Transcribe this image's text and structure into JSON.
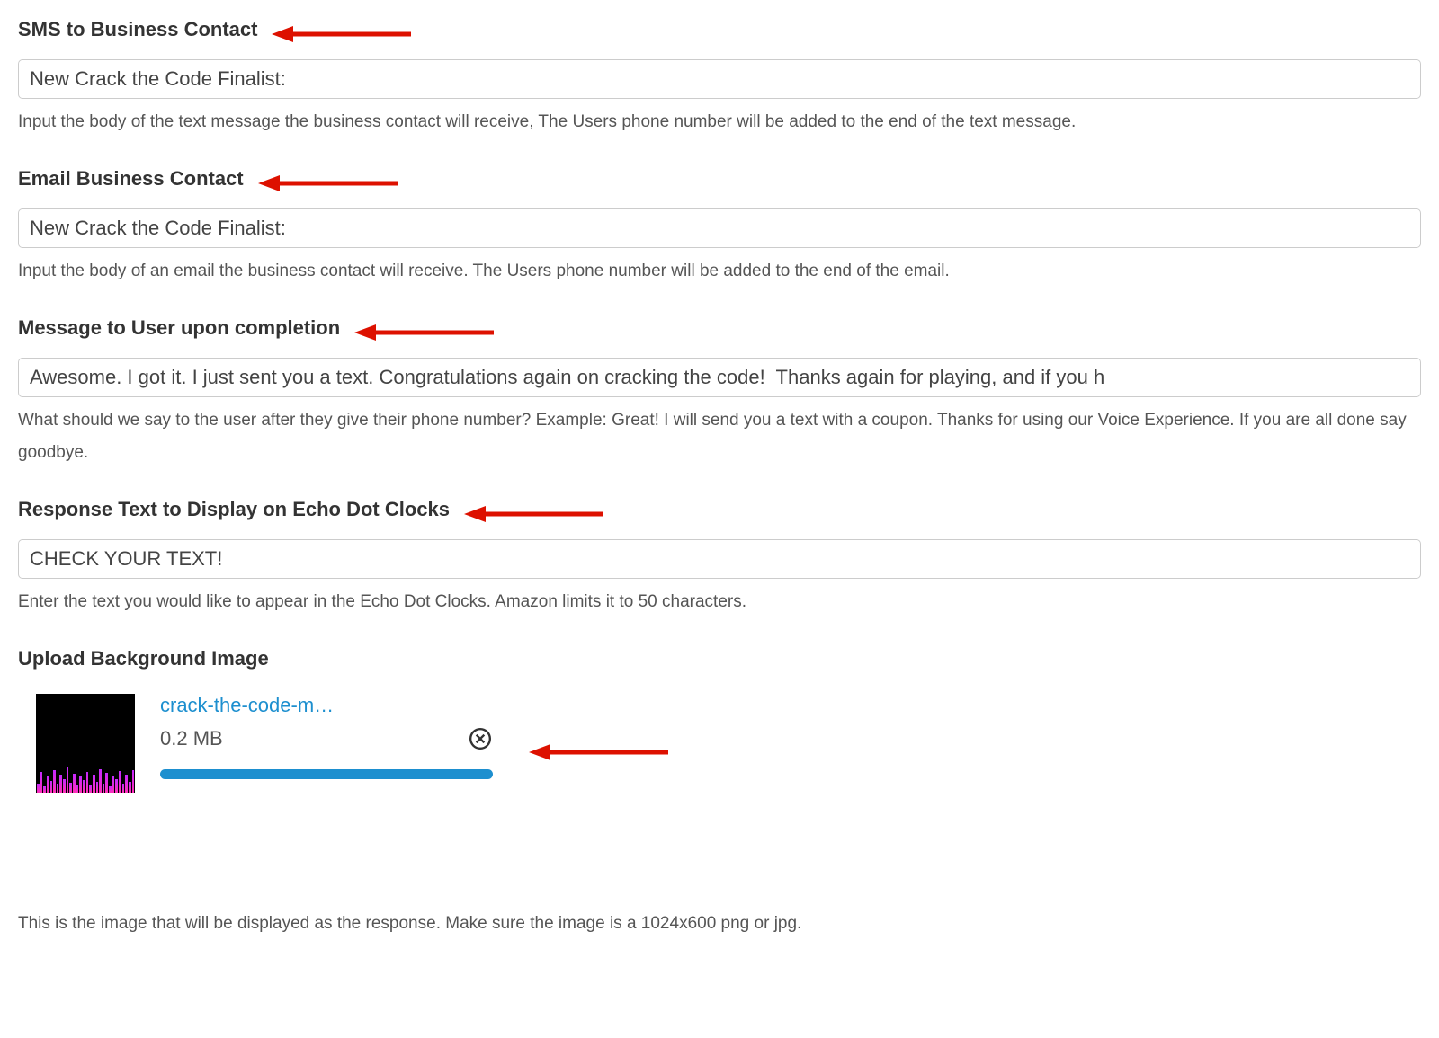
{
  "fields": {
    "sms": {
      "label": "SMS to Business Contact",
      "value": "New Crack the Code Finalist:",
      "help": "Input the body of the text message the business contact will receive, The Users phone number will be added to the end of the text message."
    },
    "email": {
      "label": "Email Business Contact",
      "value": "New Crack the Code Finalist:",
      "help": "Input the body of an email the business contact will receive. The Users phone number will be added to the end of the email."
    },
    "completion": {
      "label": "Message to User upon completion",
      "value": "Awesome. I got it. I just sent you a text. Congratulations again on cracking the code!  Thanks again for playing, and if you h",
      "help": "What should we say to the user after they give their phone number? Example: Great! I will send you a text with a coupon. Thanks for using our Voice Experience. If you are all done say goodbye."
    },
    "echoDot": {
      "label": "Response Text to Display on Echo Dot Clocks",
      "value": "CHECK YOUR TEXT!",
      "help": "Enter the text you would like to appear in the Echo Dot Clocks. Amazon limits it to 50 characters."
    }
  },
  "upload": {
    "label": "Upload Background Image",
    "filename": "crack-the-code-m…",
    "size": "0.2 MB",
    "help": "This is the image that will be displayed as the response. Make sure the image is a 1024x600 png or jpg."
  },
  "annotations": {
    "arrowColor": "#dd1100"
  }
}
